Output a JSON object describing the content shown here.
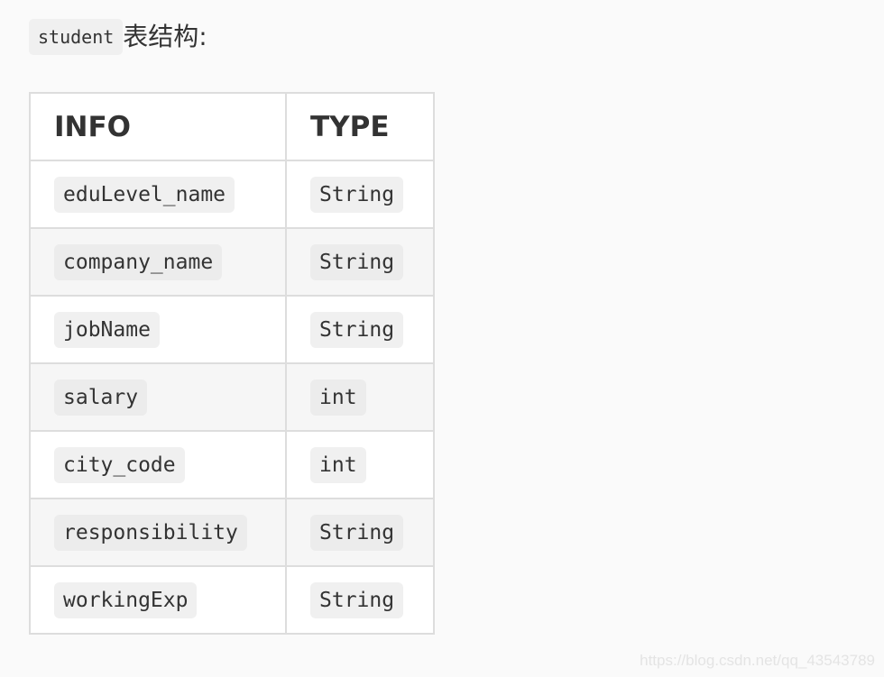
{
  "heading": {
    "code": "student",
    "text": "表结构:"
  },
  "table": {
    "headers": [
      "INFO",
      "TYPE"
    ],
    "rows": [
      {
        "info": "eduLevel_name",
        "type": "String"
      },
      {
        "info": "company_name",
        "type": "String"
      },
      {
        "info": "jobName",
        "type": "String"
      },
      {
        "info": "salary",
        "type": "int"
      },
      {
        "info": "city_code",
        "type": "int"
      },
      {
        "info": "responsibility",
        "type": "String"
      },
      {
        "info": "workingExp",
        "type": "String"
      }
    ]
  },
  "watermark": "https://blog.csdn.net/qq_43543789"
}
